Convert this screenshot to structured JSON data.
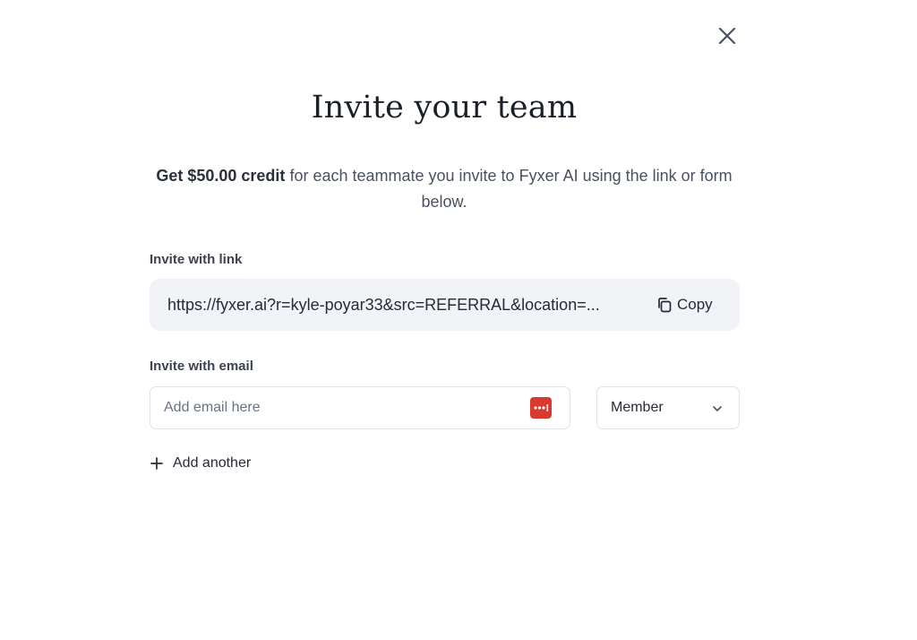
{
  "dialog": {
    "title": "Invite your team",
    "subtitle_bold": "Get $50.00 credit",
    "subtitle_rest": " for each teammate you invite to Fyxer AI using the link or form below."
  },
  "invite_link": {
    "label": "Invite with link",
    "url": "https://fyxer.ai?r=kyle-poyar33&src=REFERRAL&location=...",
    "copy_label": "Copy",
    "copy_icon": "copy-icon"
  },
  "invite_email": {
    "label": "Invite with email",
    "placeholder": "Add email here",
    "value": "",
    "password_manager_icon": "password-manager-icon",
    "role_selected": "Member",
    "role_icon": "chevron-down-icon"
  },
  "add_another": {
    "label": "Add another",
    "icon": "plus-icon"
  },
  "close": {
    "icon": "close-icon"
  },
  "colors": {
    "link_box_bg": "#f1f3f6",
    "password_icon_bg": "#d93a2f",
    "input_border": "#dfe2e7"
  }
}
